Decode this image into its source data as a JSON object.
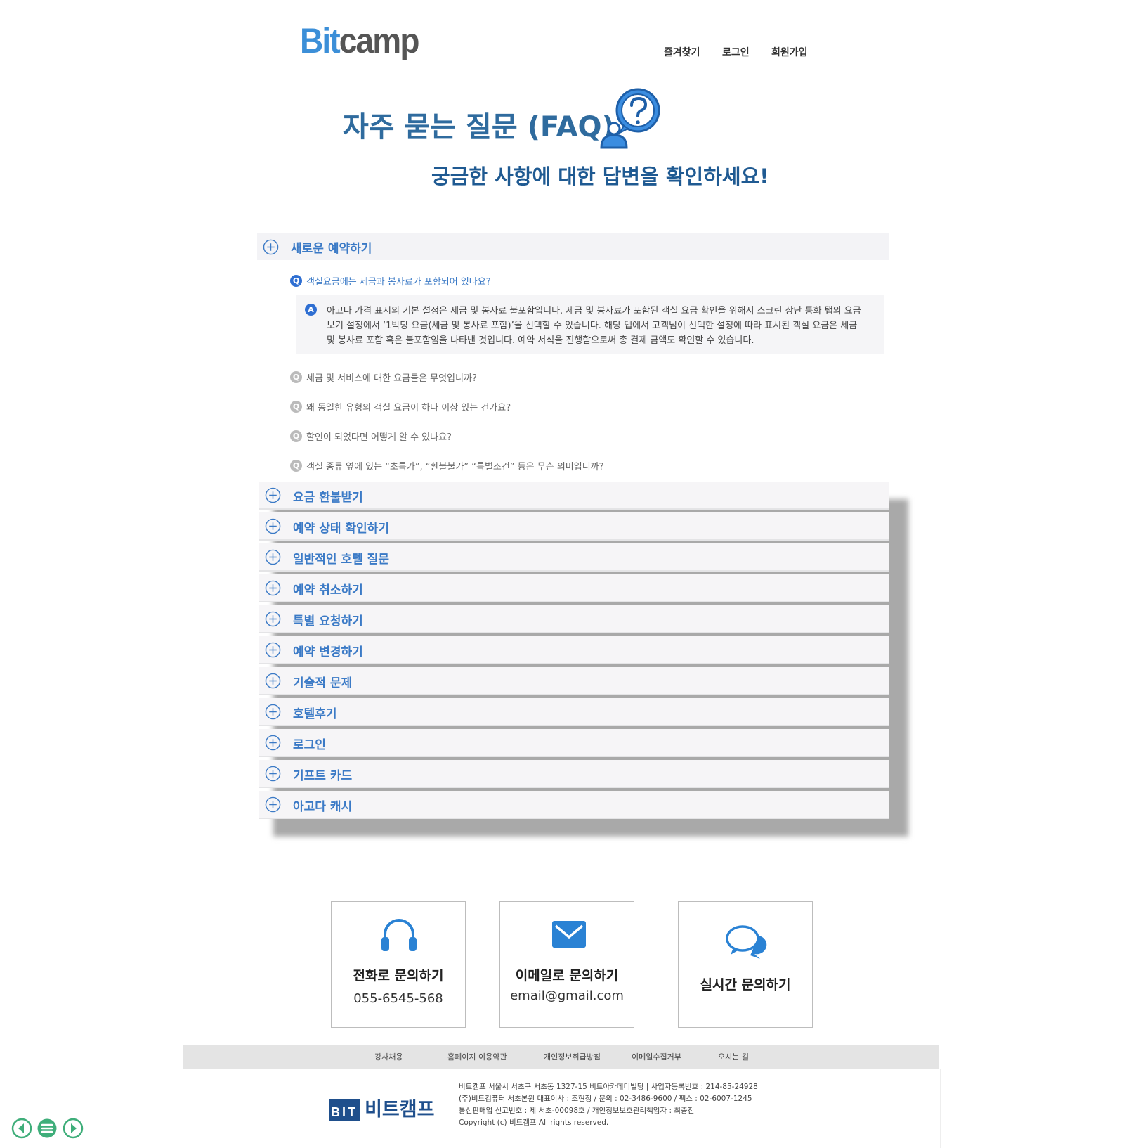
{
  "header": {
    "logo_bit": "Bit",
    "logo_camp": "camp",
    "nav": [
      "즐겨찾기",
      "로그인",
      "회원가입"
    ]
  },
  "hero": {
    "title": "자주 묻는 질문 (FAQ)",
    "subtitle": "궁금한 사항에 대한 답변을 확인하세요!"
  },
  "faq": {
    "open_category": "새로운 예약하기",
    "questions": [
      "객실요금에는 세금과 봉사료가 포함되어 있나요?",
      "세금 및 서비스에 대한 요금들은 무엇입니까?",
      "왜 동일한 유형의 객실 요금이 하나 이상 있는 건가요?",
      "할인이 되었다면 어떻게 알 수 있나요?",
      "객실 종류 옆에 있는 “초특가”, “환불불가” “특별조건” 등은 무슨 의미입니까?"
    ],
    "q_icon": "Q",
    "a_icon": "A",
    "answer": "아고다 가격 표시의 기본 설정은 세금 및 봉사료 불포함입니다. 세금 및 봉사료가 포함된 객실 요금 확인을 위해서 스크린 상단 통화 탭의 요금 보기 설정에서 ‘1박당 요금(세금 및 봉사료 포함)’을 선택할 수 있습니다. 해당 탭에서 고객님이 선택한 설정에 따라 표시된 객실 요금은 세금 및 봉사료 포함 혹은 불포함임을 나타낸 것입니다. 예약 서식을 진행함으로써 총 결제 금액도 확인할 수 있습니다.",
    "categories": [
      "요금 환불받기",
      "예약 상태 확인하기",
      "일반적인 호텔 질문",
      "예약 취소하기",
      "특별 요청하기",
      "예약 변경하기",
      "기술적 문제",
      "호텔후기",
      "로그인",
      "기프트 카드",
      "아고다 캐시"
    ]
  },
  "contact": {
    "phone_title": "전화로  문의하기",
    "phone_value": "055-6545-568",
    "email_title": "이메일로  문의하기",
    "email_value": "email@gmail.com",
    "chat_title": "실시간  문의하기"
  },
  "footer": {
    "links": [
      "강사채용",
      "홈페이지 이용약관",
      "개인정보취급방침",
      "이메일수집거부",
      "오시는 길"
    ],
    "brand_bit": "BIT",
    "brand_kr": "비트캠프",
    "info": [
      "비트캠프 서울시 서초구 서초동 1327-15 비트아카데미빌딩 |  사업자등록번호 : 214-85-24928",
      "(주)비트컴퓨터 서초본원 대표이사 : 조현정 / 문의 : 02-3486-9600 / 팩스 : 02-6007-1245",
      "통신판매업 신고번호 : 제 서초-00098호 / 개인정보보호관리책임자 : 최종진",
      "Copyright (c) 비트캠프 All rights reserved."
    ]
  },
  "colors": {
    "accent": "#3b7ac6",
    "title": "#2f6b9e",
    "logo_blue": "#3c8fd8",
    "control_green": "#3fae7a"
  }
}
